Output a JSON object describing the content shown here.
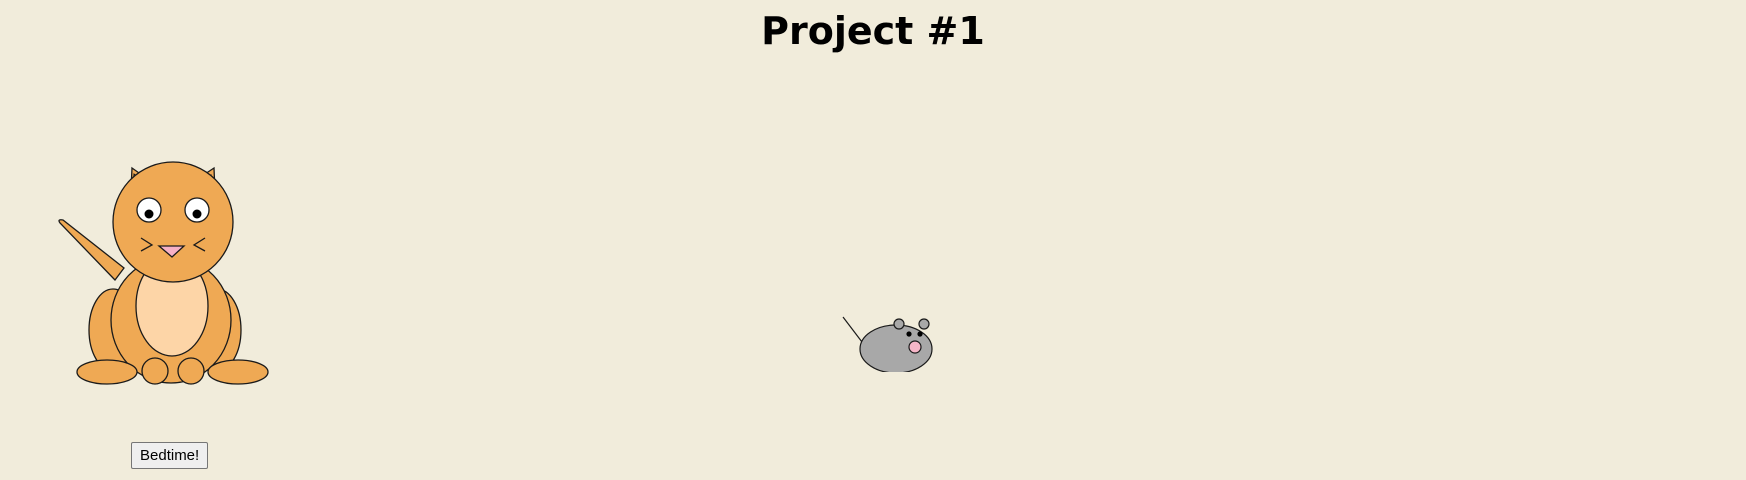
{
  "page": {
    "title": "Project #1",
    "background": "#f1ecdb"
  },
  "cat": {
    "fur_color": "#efa954",
    "belly_color": "#fdd5a7",
    "ear_inner_color": "#f7b1c6",
    "nose_color": "#f7b1c6"
  },
  "mouse": {
    "body_color": "#a8a8a8",
    "nose_color": "#f6b6c8"
  },
  "controls": {
    "bedtime_label": "Bedtime!"
  }
}
